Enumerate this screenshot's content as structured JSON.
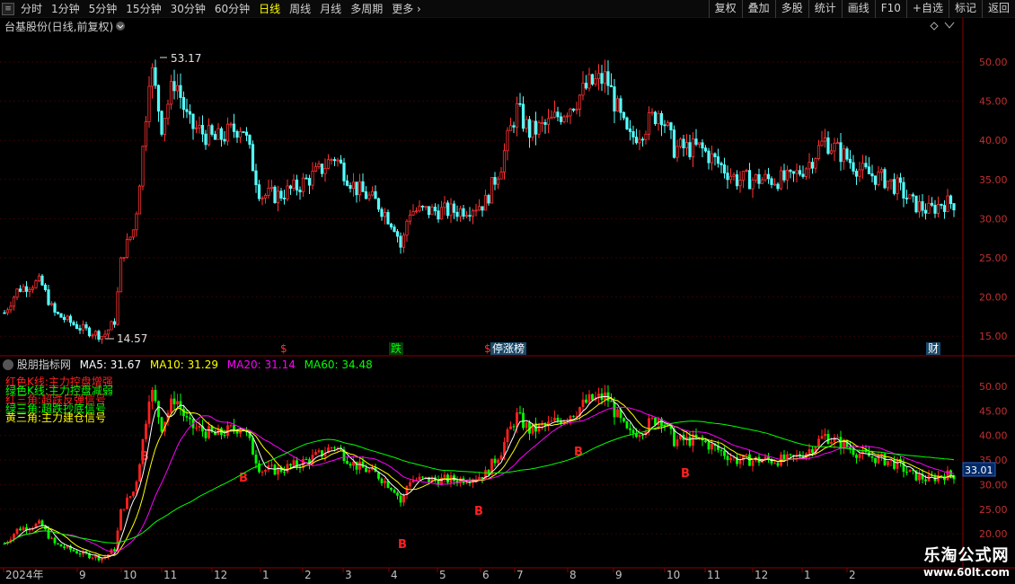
{
  "toolbar": {
    "periods": [
      {
        "label": "分时",
        "active": false
      },
      {
        "label": "1分钟",
        "active": false
      },
      {
        "label": "5分钟",
        "active": false
      },
      {
        "label": "15分钟",
        "active": false
      },
      {
        "label": "30分钟",
        "active": false
      },
      {
        "label": "60分钟",
        "active": false
      },
      {
        "label": "日线",
        "active": true
      },
      {
        "label": "周线",
        "active": false
      },
      {
        "label": "月线",
        "active": false
      },
      {
        "label": "多周期",
        "active": false
      },
      {
        "label": "更多",
        "active": false
      }
    ],
    "more_chevron": "›",
    "buttons": [
      "复权",
      "叠加",
      "多股",
      "统计",
      "画线",
      "F10",
      "+自选",
      "标记",
      "返回"
    ]
  },
  "main": {
    "title": "台基股份(日线,前复权)",
    "y_ticks": [
      "50.00",
      "45.00",
      "40.00",
      "35.00",
      "30.00",
      "25.00",
      "20.00",
      "15.00"
    ],
    "high_label": "53.17",
    "low_label": "14.57",
    "event_markers": [
      {
        "text": "$",
        "color": "#ff3030"
      },
      {
        "text": "跌",
        "color": "#00ff00"
      },
      {
        "text": "$",
        "color": "#ff3030"
      },
      {
        "text": "停涨榜",
        "color": "#ffffff"
      },
      {
        "text": "财",
        "color": "#ffffff"
      }
    ]
  },
  "indicator": {
    "name": "股朋指标网",
    "ma": [
      {
        "label": "MA5: 31.67",
        "color": "#ffffff"
      },
      {
        "label": "MA10: 31.29",
        "color": "#ffff00"
      },
      {
        "label": "MA20: 31.14",
        "color": "#ff00ff"
      },
      {
        "label": "MA60: 34.48",
        "color": "#00ff00"
      }
    ],
    "legend": [
      {
        "text": "红色K线:主力控盘增强",
        "color": "#ff2020"
      },
      {
        "text": "绿色K线:主力控盘减弱",
        "color": "#00ff00"
      },
      {
        "text": "红三角:超跌反弹信号",
        "color": "#ff2020"
      },
      {
        "text": "绿三角:超跌抄底信号",
        "color": "#00ff00"
      },
      {
        "text": "黄三角:主力建仓信号",
        "color": "#ffff00"
      }
    ],
    "y_ticks": [
      "50.00",
      "45.00",
      "40.00",
      "35.00",
      "30.00",
      "25.00",
      "20.00"
    ],
    "current_value": "33.01",
    "signal_label": "B"
  },
  "x_axis": {
    "labels": [
      "2024年",
      "9",
      "10",
      "11",
      "12",
      "1",
      "2",
      "3",
      "4",
      "5",
      "6",
      "7",
      "8",
      "9",
      "10",
      "11",
      "12",
      "1",
      "2"
    ]
  },
  "watermark": {
    "brand": "乐淘公式网",
    "url": "www.60lt.com"
  },
  "colors": {
    "up": "#ff3232",
    "down": "#54ffff",
    "grid": "#3c0000",
    "axis": "#8b0000"
  }
}
